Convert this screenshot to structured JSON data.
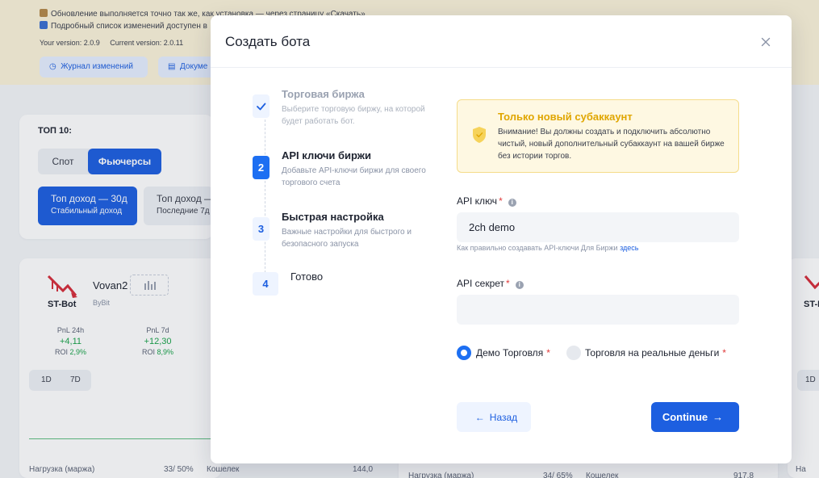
{
  "colors": {
    "accent": "#1d5fe0",
    "warning": "#e0a600",
    "required": "#e03a3a",
    "positive": "#1aa34a"
  },
  "background": {
    "banner": {
      "line1": "Обновление выполняется точно так же, как установка — через страницу «Скачать»",
      "line2": "Подробный список изменений доступен в",
      "your_version": "Your version: 2.0.9",
      "current_version": "Current version: 2.0.11",
      "changelog_button": "Журнал изменений",
      "docs_button": "Докуме"
    },
    "top10": {
      "title": "ТОП 10:",
      "tab_spot": "Спот",
      "tab_futures": "Фьючерсы",
      "card1_title": "Топ доход — 30д",
      "card1_sub": "Стабильный доход",
      "card2_title": "Топ доход —",
      "card2_sub": "Последние 7д"
    },
    "bot_card": {
      "logo_text": "ST-Bot",
      "name": "Vovan2",
      "exchange": "ByBit",
      "pnl24_label": "PnL 24h",
      "pnl24_value": "+4,11",
      "roi24_label": "ROI",
      "roi24_value": "2,9%",
      "pnl7_label": "PnL 7d",
      "pnl7_value": "+12,30",
      "roi7_label": "ROI",
      "roi7_value": "8,9%",
      "tab_1d": "1D",
      "tab_7d": "7D",
      "load_label": "Нагрузка (маржа)",
      "load_value": "33/ 50%",
      "wallet_label": "Кошелек",
      "wallet_value": "144,0"
    },
    "bot_card2": {
      "load_label": "Нагрузка (маржа)",
      "load_value": "34/ 65%",
      "wallet_label": "Кошелек",
      "wallet_value": "917,8"
    },
    "bot_card3": {
      "logo_text": "ST-I",
      "tab_1d": "1D",
      "load_label": "На"
    }
  },
  "modal": {
    "title": "Создать бота",
    "steps": [
      {
        "number": "",
        "title": "Торговая биржа",
        "desc": "Выберите торговую биржу, на которой будет работать бот.",
        "state": "done"
      },
      {
        "number": "2",
        "title": "API ключи биржи",
        "desc": "Добавьте API-ключи биржи для своего торгового счета",
        "state": "active"
      },
      {
        "number": "3",
        "title": "Быстрая настройка",
        "desc": "Важные настройки для быстрого и безопасного запуска",
        "state": "idle"
      },
      {
        "number": "4",
        "title": "Готово",
        "desc": "",
        "state": "idle"
      }
    ],
    "warning": {
      "title": "Только новый субаккаунт",
      "text": "Внимание! Вы должны создать и подключить абсолютно чистый, новый дополнительный субаккаунт на вашей бирже без истории торгов."
    },
    "api_key": {
      "label": "API ключ",
      "required": "*",
      "value": "2ch demo",
      "hint": "Как правильно создавать API-ключи Для Биржи",
      "hint_link": "здесь"
    },
    "api_secret": {
      "label": "API секрет",
      "required": "*",
      "value": ""
    },
    "mode": {
      "demo_label": "Демо Торговля",
      "real_label": "Торговля на реальные деньги",
      "required": "*",
      "selected": "demo"
    },
    "buttons": {
      "back": "Назад",
      "continue": "Continue"
    }
  }
}
